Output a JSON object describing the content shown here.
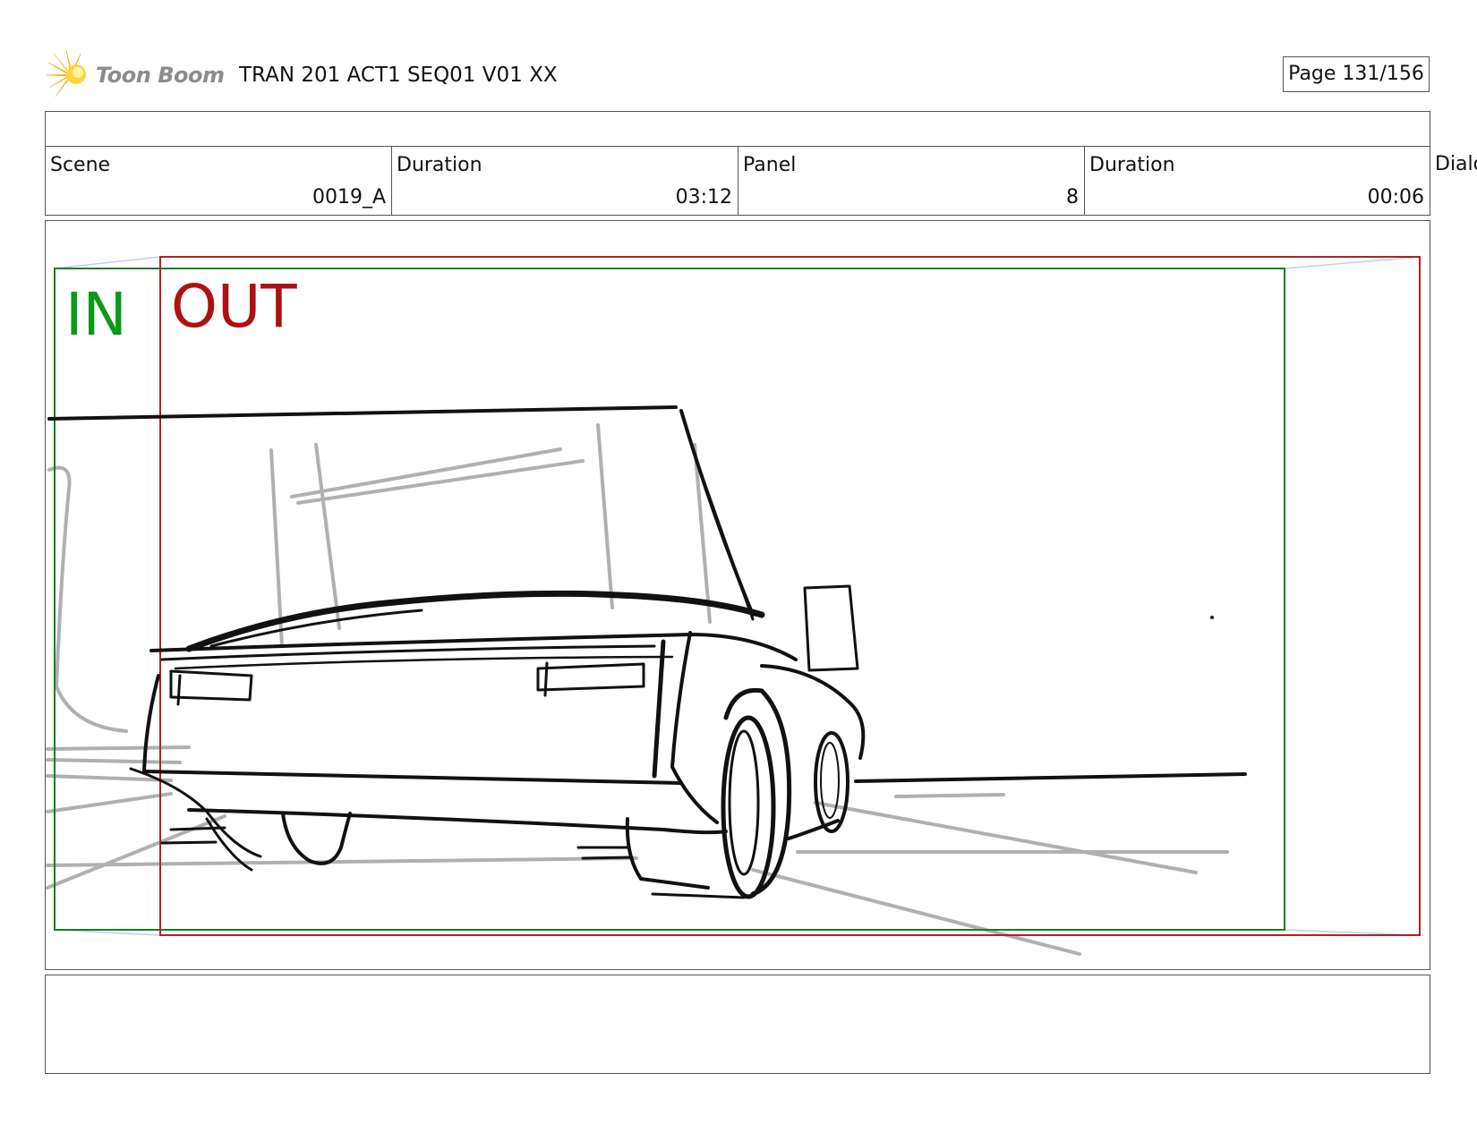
{
  "header": {
    "logo_text": "Toon Boom",
    "document_title": "TRAN 201 ACT1 SEQ01 V01 XX",
    "page_label": "Page 131/156"
  },
  "info": {
    "scene_label": "Scene",
    "scene_value": "0019_A",
    "scene_duration_label": "Duration",
    "scene_duration_value": "03:12",
    "panel_label": "Panel",
    "panel_value": "8",
    "panel_duration_label": "Duration",
    "panel_duration_value": "00:06",
    "dialog_label": "Dialog"
  },
  "panel": {
    "in_label": "IN",
    "out_label": "OUT",
    "in_color": "#0a9a1a",
    "out_color": "#b01010",
    "camera_in_frame_color": "#1e7a2a",
    "camera_out_frame_color": "#b22222",
    "sketch_description_hidden": false
  },
  "notes": {
    "text": ""
  }
}
